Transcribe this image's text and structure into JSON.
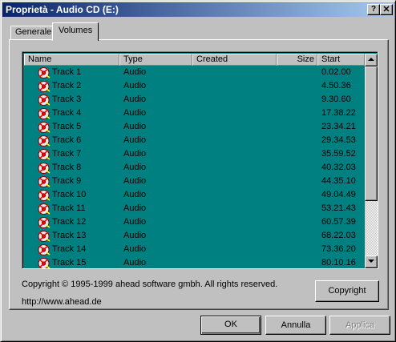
{
  "window": {
    "title": "Proprietà - Audio CD (E:)",
    "help_label": "?",
    "close_label": "✕"
  },
  "tabs": [
    {
      "label": "Generale"
    },
    {
      "label": "Volumes",
      "selected": true
    }
  ],
  "list": {
    "columns": [
      "Name",
      "Type",
      "Created",
      "Size",
      "Start"
    ],
    "rows": [
      {
        "name": "Track 1",
        "type": "Audio",
        "created": "",
        "size": "",
        "start": "0.02.00"
      },
      {
        "name": "Track 2",
        "type": "Audio",
        "created": "",
        "size": "",
        "start": "4.50.36"
      },
      {
        "name": "Track 3",
        "type": "Audio",
        "created": "",
        "size": "",
        "start": "9.30.60"
      },
      {
        "name": "Track 4",
        "type": "Audio",
        "created": "",
        "size": "",
        "start": "17.38.22"
      },
      {
        "name": "Track 5",
        "type": "Audio",
        "created": "",
        "size": "",
        "start": "23.34.21"
      },
      {
        "name": "Track 6",
        "type": "Audio",
        "created": "",
        "size": "",
        "start": "29.34.53"
      },
      {
        "name": "Track 7",
        "type": "Audio",
        "created": "",
        "size": "",
        "start": "35.59.52"
      },
      {
        "name": "Track 8",
        "type": "Audio",
        "created": "",
        "size": "",
        "start": "40.32.03"
      },
      {
        "name": "Track 9",
        "type": "Audio",
        "created": "",
        "size": "",
        "start": "44.35.10"
      },
      {
        "name": "Track 10",
        "type": "Audio",
        "created": "",
        "size": "",
        "start": "49.04.49"
      },
      {
        "name": "Track 11",
        "type": "Audio",
        "created": "",
        "size": "",
        "start": "53.21.43"
      },
      {
        "name": "Track 12",
        "type": "Audio",
        "created": "",
        "size": "",
        "start": "60.57.39"
      },
      {
        "name": "Track 13",
        "type": "Audio",
        "created": "",
        "size": "",
        "start": "68.22.03"
      },
      {
        "name": "Track 14",
        "type": "Audio",
        "created": "",
        "size": "",
        "start": "73.36.20"
      },
      {
        "name": "Track 15",
        "type": "Audio",
        "created": "",
        "size": "",
        "start": "80.10.16"
      }
    ],
    "row_icon": "audio-track-icon",
    "background_color": "#008080"
  },
  "footer": {
    "copyright_text": "Copyright © 1995-1999 ahead software gmbh. All rights reserved.",
    "url": "http://www.ahead.de",
    "copyright_button": "Copyright"
  },
  "buttons": {
    "ok": "OK",
    "cancel": "Annulla",
    "apply": "Applica",
    "apply_enabled": false
  },
  "colors": {
    "titlebar_start": "#0a246a",
    "titlebar_end": "#a6caf0",
    "face": "#c0c0c0"
  }
}
